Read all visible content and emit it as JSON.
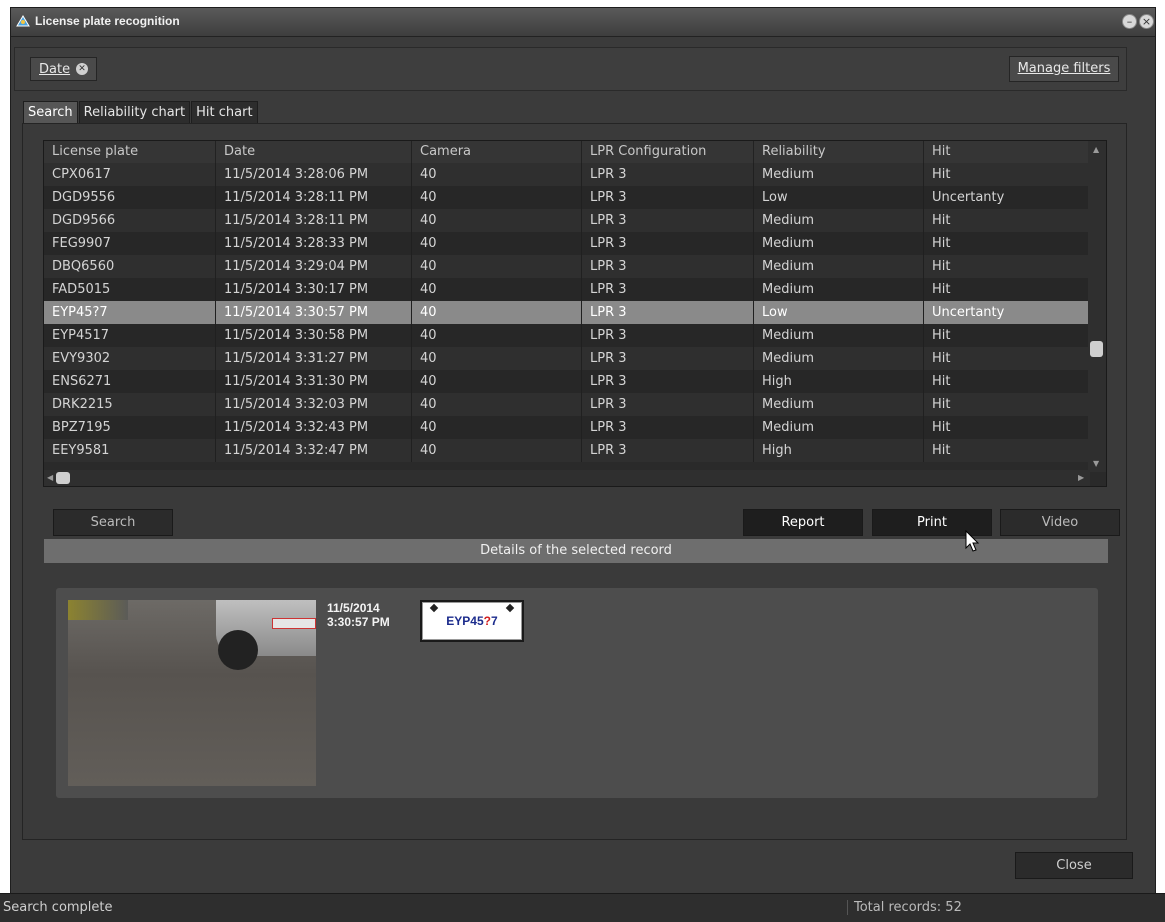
{
  "window": {
    "title": "License plate recognition"
  },
  "filters": {
    "chip_label": "Date",
    "manage_label": "Manage filters"
  },
  "tabs": [
    {
      "label": "Search",
      "active": true
    },
    {
      "label": "Reliability chart",
      "active": false
    },
    {
      "label": "Hit chart",
      "active": false
    }
  ],
  "table": {
    "columns": [
      "License plate",
      "Date",
      "Camera",
      "LPR Configuration",
      "Reliability",
      "Hit"
    ],
    "rows": [
      [
        "CPX0617",
        "11/5/2014 3:28:06 PM",
        "40",
        "LPR 3",
        "Medium",
        "Hit"
      ],
      [
        "DGD9556",
        "11/5/2014 3:28:11 PM",
        "40",
        "LPR 3",
        "Low",
        "Uncertanty"
      ],
      [
        "DGD9566",
        "11/5/2014 3:28:11 PM",
        "40",
        "LPR 3",
        "Medium",
        "Hit"
      ],
      [
        "FEG9907",
        "11/5/2014 3:28:33 PM",
        "40",
        "LPR 3",
        "Medium",
        "Hit"
      ],
      [
        "DBQ6560",
        "11/5/2014 3:29:04 PM",
        "40",
        "LPR 3",
        "Medium",
        "Hit"
      ],
      [
        "FAD5015",
        "11/5/2014 3:30:17 PM",
        "40",
        "LPR 3",
        "Medium",
        "Hit"
      ],
      [
        "EYP45?7",
        "11/5/2014 3:30:57 PM",
        "40",
        "LPR 3",
        "Low",
        "Uncertanty"
      ],
      [
        "EYP4517",
        "11/5/2014 3:30:58 PM",
        "40",
        "LPR 3",
        "Medium",
        "Hit"
      ],
      [
        "EVY9302",
        "11/5/2014 3:31:27 PM",
        "40",
        "LPR 3",
        "Medium",
        "Hit"
      ],
      [
        "ENS6271",
        "11/5/2014 3:31:30 PM",
        "40",
        "LPR 3",
        "High",
        "Hit"
      ],
      [
        "DRK2215",
        "11/5/2014 3:32:03 PM",
        "40",
        "LPR 3",
        "Medium",
        "Hit"
      ],
      [
        "BPZ7195",
        "11/5/2014 3:32:43 PM",
        "40",
        "LPR 3",
        "Medium",
        "Hit"
      ],
      [
        "EEY9581",
        "11/5/2014 3:32:47 PM",
        "40",
        "LPR 3",
        "High",
        "Hit"
      ]
    ],
    "selected_index": 6
  },
  "buttons": {
    "search": "Search",
    "report": "Report",
    "print": "Print",
    "video": "Video",
    "close": "Close"
  },
  "details": {
    "header": "Details of the selected record",
    "date": "11/5/2014",
    "time": "3:30:57 PM",
    "plate_prefix": "EYP45",
    "plate_unknown": "?",
    "plate_suffix": "7"
  },
  "status": {
    "left": "Search complete",
    "right": "Total records: 52"
  },
  "icons": [
    "app-icon",
    "minimize-icon",
    "close-icon",
    "remove-filter-icon",
    "mouse-cursor-icon"
  ]
}
